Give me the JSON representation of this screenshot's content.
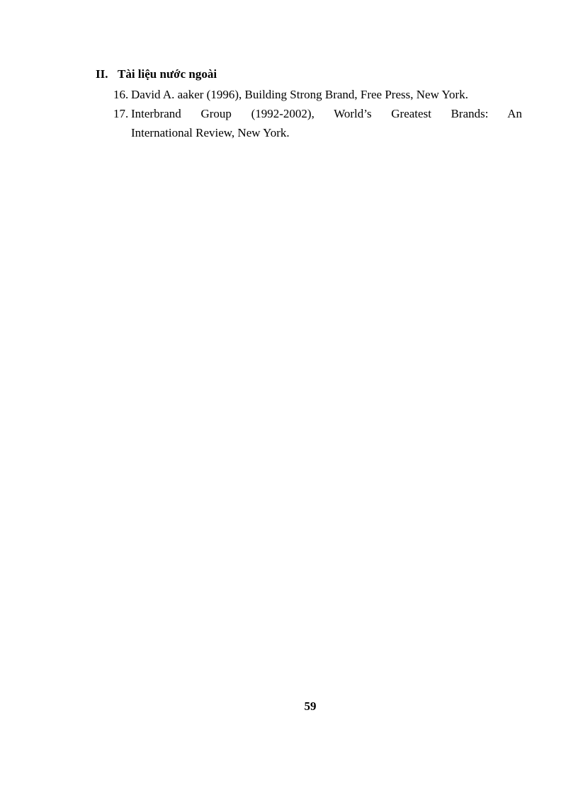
{
  "section": {
    "number": "II.",
    "title": "Tài liệu nước ngoài"
  },
  "references": [
    {
      "number": "16.",
      "text": "David A. aaker (1996), Building  Strong Brand, Free Press, New York."
    },
    {
      "number": "17.",
      "line1": "Interbrand Group (1992-2002), World’s Greatest Brands: An",
      "line2": "International  Review, New York."
    }
  ],
  "page_number": "59"
}
